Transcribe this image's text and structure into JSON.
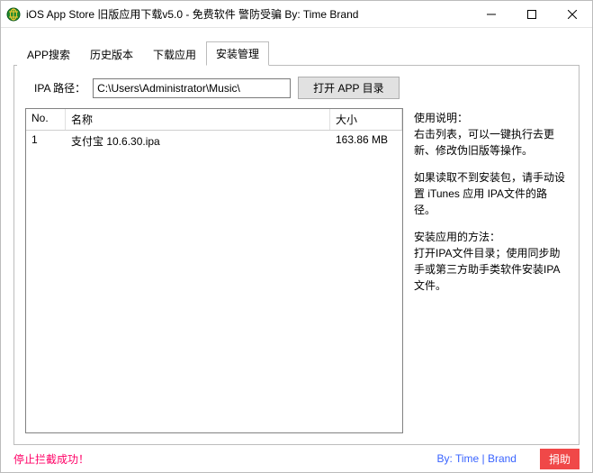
{
  "window": {
    "title": "iOS App Store 旧版应用下载v5.0 - 免费软件 警防受骗 By: Time Brand"
  },
  "tabs": {
    "items": [
      "APP搜索",
      "历史版本",
      "下载应用",
      "安装管理"
    ],
    "active_index": 3
  },
  "path": {
    "label": "IPA 路径：",
    "value": "C:\\Users\\Administrator\\Music\\",
    "open_button": "打开 APP 目录"
  },
  "table": {
    "headers": {
      "no": "No.",
      "name": "名称",
      "size": "大小"
    },
    "rows": [
      {
        "no": "1",
        "name": "支付宝 10.6.30.ipa",
        "size": "163.86 MB"
      }
    ]
  },
  "instructions": {
    "p1_title": "使用说明：",
    "p1_body": "右击列表，可以一键执行去更新、修改伪旧版等操作。",
    "p2": "如果读取不到安装包，请手动设置 iTunes 应用 IPA文件的路径。",
    "p3_title": "安装应用的方法：",
    "p3_body": "打开IPA文件目录；使用同步助手或第三方助手类软件安装IPA文件。"
  },
  "footer": {
    "status": "停止拦截成功！",
    "byline": "By: Time | Brand",
    "donate": "捐助"
  }
}
